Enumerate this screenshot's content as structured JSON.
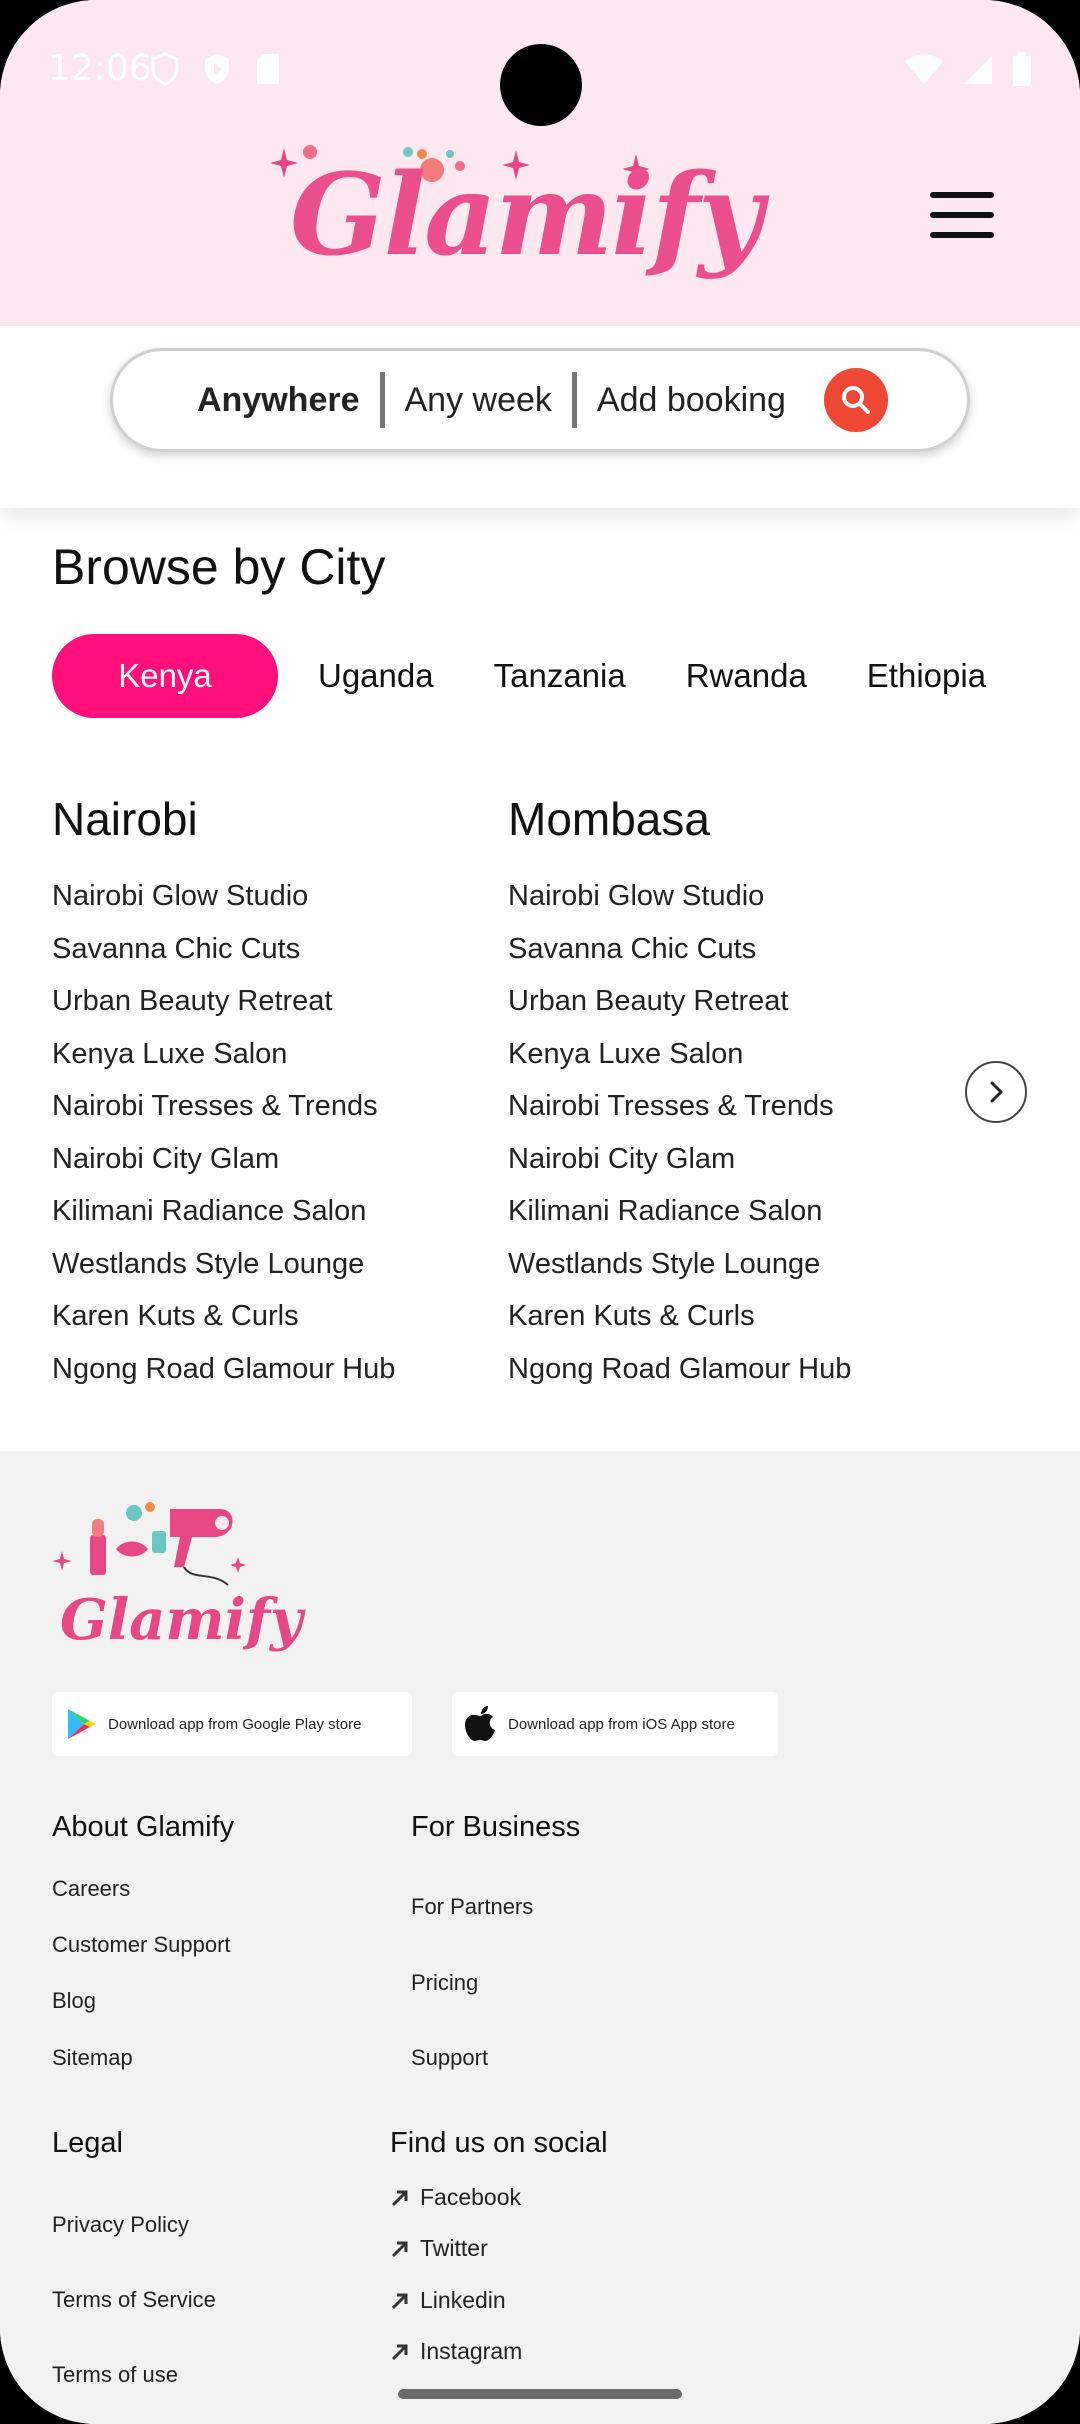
{
  "status_bar": {
    "time": "12:06"
  },
  "brand": {
    "name": "Glamify",
    "accent": "#ff0f7b",
    "logo_pink": "#ec4f8e",
    "search_button_color": "#ee4733"
  },
  "search": {
    "location": "Anywhere",
    "date": "Any week",
    "booking": "Add booking"
  },
  "browse": {
    "title": "Browse by City",
    "countries": [
      "Kenya",
      "Uganda",
      "Tanzania",
      "Rwanda",
      "Ethiopia"
    ],
    "active_country": "Kenya",
    "cities": [
      {
        "name": "Nairobi",
        "salons": [
          "Nairobi Glow Studio",
          "Savanna Chic Cuts",
          "Urban Beauty Retreat",
          "Kenya Luxe Salon",
          "Nairobi Tresses & Trends",
          "Nairobi City Glam",
          "Kilimani Radiance Salon",
          "Westlands Style Lounge",
          "Karen Kuts & Curls",
          "Ngong Road Glamour Hub"
        ]
      },
      {
        "name": "Mombasa",
        "salons": [
          "Nairobi Glow Studio",
          "Savanna Chic Cuts",
          "Urban Beauty Retreat",
          "Kenya Luxe Salon",
          "Nairobi Tresses & Trends",
          "Nairobi City Glam",
          "Kilimani Radiance Salon",
          "Westlands Style Lounge",
          "Karen Kuts & Curls",
          "Ngong Road Glamour Hub"
        ]
      }
    ]
  },
  "footer": {
    "logo_text": "Glamify",
    "google_play": "Download app from Google Play store",
    "app_store": "Download app from iOS App store",
    "about": {
      "title": "About Glamify",
      "links": [
        "Careers",
        "Customer Support",
        "Blog",
        "Sitemap"
      ]
    },
    "business": {
      "title": "For Business",
      "links": [
        "For Partners",
        "Pricing",
        "Support"
      ]
    },
    "legal": {
      "title": "Legal",
      "links": [
        "Privacy Policy",
        "Terms of Service",
        "Terms of use"
      ]
    },
    "social": {
      "title": "Find us on social",
      "links": [
        "Facebook",
        "Twitter",
        "Linkedin",
        "Instagram"
      ]
    }
  }
}
